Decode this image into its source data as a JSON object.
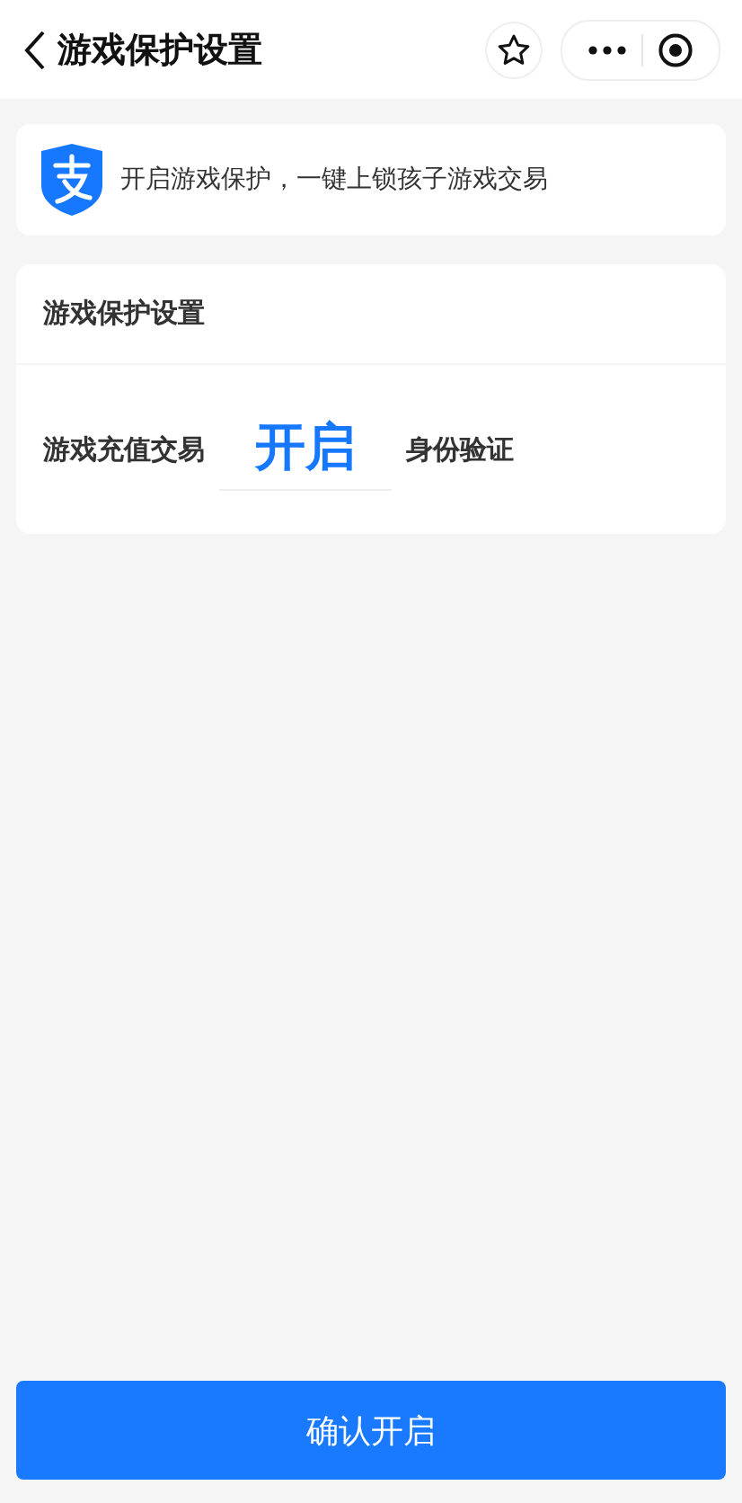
{
  "header": {
    "title": "游戏保护设置"
  },
  "banner": {
    "text": "开启游戏保护，一键上锁孩子游戏交易"
  },
  "settings": {
    "title": "游戏保护设置",
    "row": {
      "label": "游戏充值交易",
      "picker_value": "开启",
      "suffix": "身份验证"
    }
  },
  "confirm_button": "确认开启"
}
